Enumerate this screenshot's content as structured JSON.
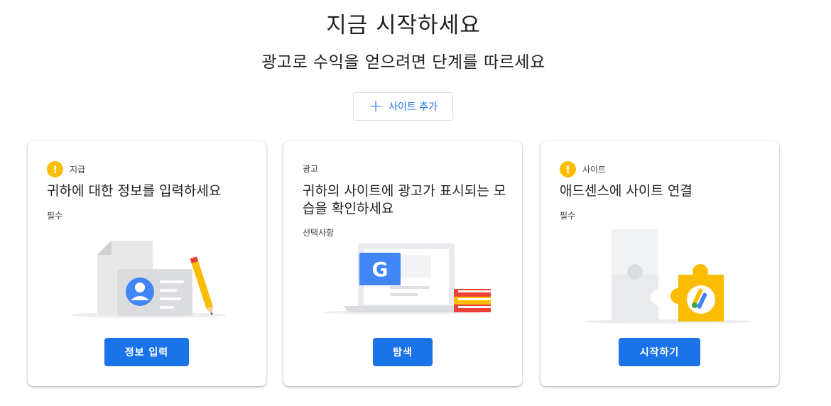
{
  "header": {
    "title": "지금 시작하세요",
    "subtitle": "광고로 수익을 얻으려면 단계를 따르세요",
    "add_site_label": "사이트 추가"
  },
  "cards": [
    {
      "tag": "지급",
      "title": "귀하에 대한 정보를 입력하세요",
      "note": "필수",
      "button": "정보 입력",
      "has_warning": true,
      "illustration": "id-card-document-pencil"
    },
    {
      "tag": "광고",
      "title": "귀하의 사이트에 광고가 표시되는 모습을 확인하세요",
      "note": "선택사항",
      "button": "탐색",
      "has_warning": false,
      "illustration": "laptop-google-books"
    },
    {
      "tag": "사이트",
      "title": "애드센스에 사이트 연결",
      "note": "필수",
      "button": "시작하기",
      "has_warning": true,
      "illustration": "puzzle-pieces"
    }
  ],
  "colors": {
    "accent": "#1a73e8",
    "warning": "#fbbc04",
    "google_blue": "#4285f4",
    "google_red": "#ea4335",
    "google_green": "#34a853"
  }
}
